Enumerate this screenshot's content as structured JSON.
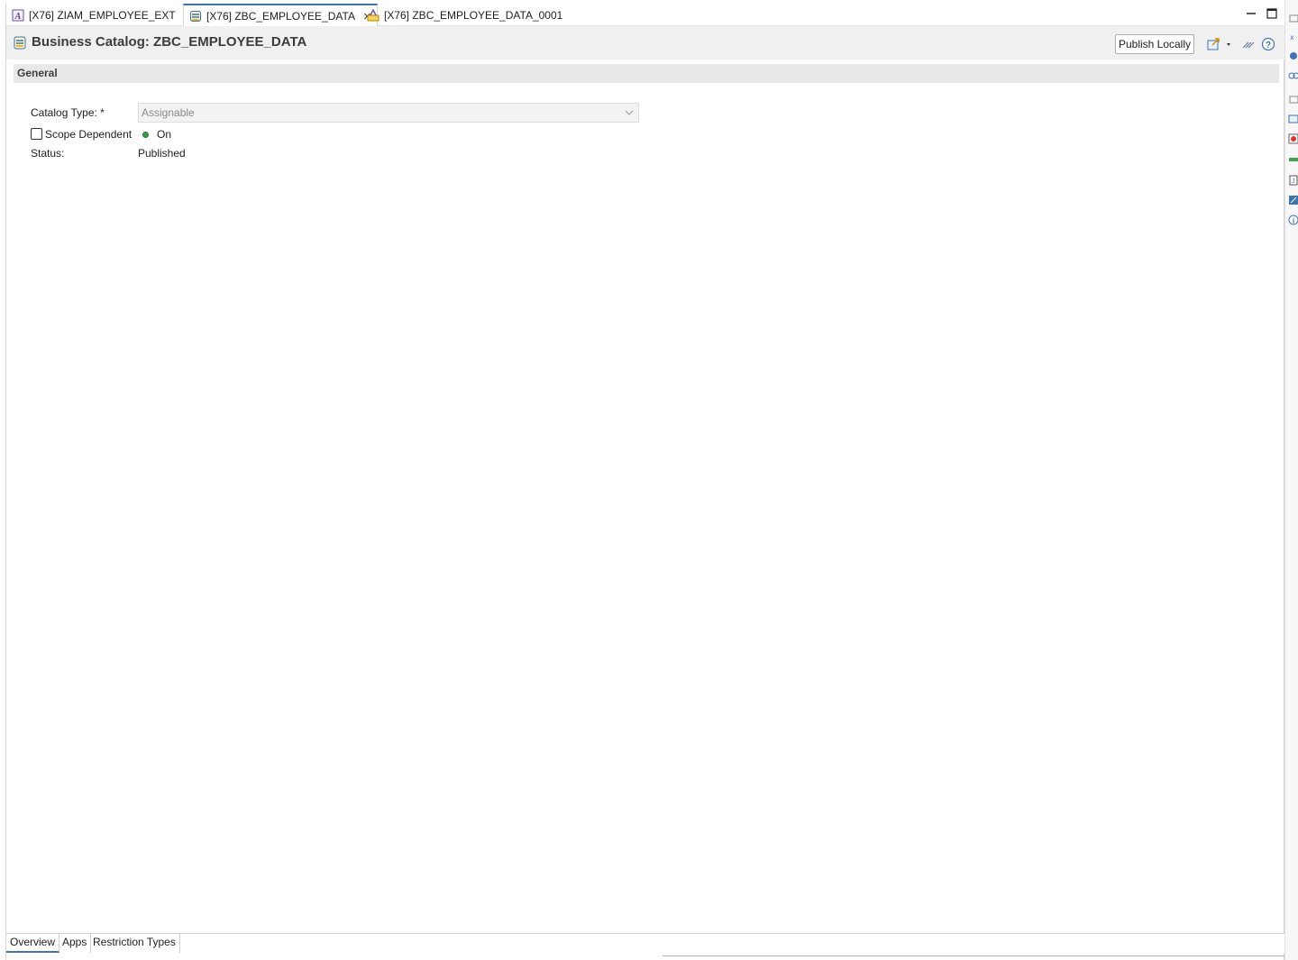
{
  "tabs": [
    {
      "label": "[X76] ZIAM_EMPLOYEE_EXT",
      "icon": "abap-class-icon"
    },
    {
      "label": "[X76] ZBC_EMPLOYEE_DATA",
      "icon": "business-catalog-icon",
      "active": true
    },
    {
      "label": "[X76] ZBC_EMPLOYEE_DATA_0001",
      "icon": "app-assignment-icon"
    }
  ],
  "header": {
    "title": "Business Catalog: ZBC_EMPLOYEE_DATA",
    "publish_label": "Publish Locally"
  },
  "section": {
    "title": "General"
  },
  "form": {
    "catalog_type_label": "Catalog Type: *",
    "catalog_type_value": "Assignable",
    "scope_dependent_label": "Scope Dependent",
    "scope_dependent_checked": false,
    "scope_status": "On",
    "status_label": "Status:",
    "status_value": "Published"
  },
  "bottom_tabs": [
    "Overview",
    "Apps",
    "Restriction Types"
  ],
  "colors": {
    "accent": "#3b73b9",
    "on_indicator": "#2f9e44"
  }
}
